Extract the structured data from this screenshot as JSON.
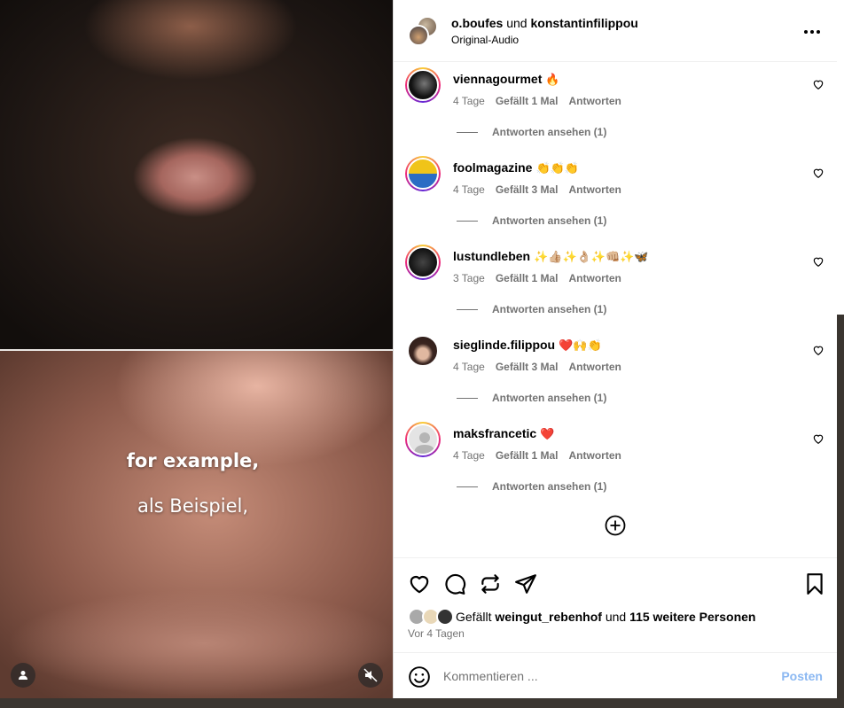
{
  "video": {
    "caption_1": "for example,",
    "caption_2": "als Beispiel,"
  },
  "header": {
    "user1": "o.boufes",
    "connector": "und",
    "user2": "konstantinfilippou",
    "audio": "Original-Audio"
  },
  "comments": [
    {
      "name": "viennagourmet",
      "emoji": "🔥",
      "age": "4 Tage",
      "likes": "Gefällt 1 Mal",
      "reply": "Antworten",
      "view_replies": "Antworten ansehen (1)",
      "avatar_color": "#2b2b2b",
      "ring": true
    },
    {
      "name": "foolmagazine",
      "emoji": "👏👏👏",
      "age": "4 Tage",
      "likes": "Gefällt 3 Mal",
      "reply": "Antworten",
      "view_replies": "Antworten ansehen (1)",
      "avatar_color": "#f0c419",
      "ring": true
    },
    {
      "name": "lustundleben",
      "emoji": "✨👍🏼✨👌🏼✨👊🏼✨🦋",
      "age": "3 Tage",
      "likes": "Gefällt 1 Mal",
      "reply": "Antworten",
      "view_replies": "Antworten ansehen (1)",
      "avatar_color": "#111111",
      "ring": true
    },
    {
      "name": "sieglinde.filippou",
      "emoji": "❤️🙌👏",
      "age": "4 Tage",
      "likes": "Gefällt 3 Mal",
      "reply": "Antworten",
      "view_replies": "Antworten ansehen (1)",
      "avatar_color": "#5a3e36",
      "ring": false
    },
    {
      "name": "maksfrancetic",
      "emoji": "❤️",
      "age": "4 Tage",
      "likes": "Gefällt 1 Mal",
      "reply": "Antworten",
      "view_replies": "Antworten ansehen (1)",
      "avatar_color": "#d6d6d6",
      "ring": true
    }
  ],
  "likes": {
    "prefix": "Gefällt",
    "user": "weingut_rebenhof",
    "connector": "und",
    "others": "115 weitere Personen",
    "time_ago": "Vor 4 Tagen"
  },
  "comment_bar": {
    "placeholder": "Kommentieren ...",
    "post_label": "Posten"
  },
  "colors": {
    "post_button": "#8bb8f2",
    "meta_text": "#737373"
  }
}
